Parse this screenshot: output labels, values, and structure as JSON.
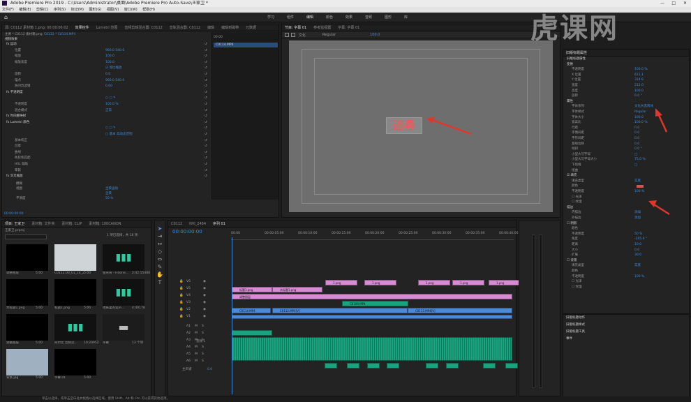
{
  "window": {
    "title": "Adobe Premiere Pro 2019 - C:\\Users\\Administrator\\桌面\\Adobe Premiere Pro Auto-Save\\王家卫 *"
  },
  "menu": [
    "文件(F)",
    "编辑(E)",
    "剪辑(C)",
    "序列(S)",
    "标记(M)",
    "图形(G)",
    "视图(V)",
    "窗口(W)",
    "帮助(H)"
  ],
  "workspaces": [
    "学习",
    "组件",
    "编辑",
    "颜色",
    "效果",
    "音频",
    "图形",
    "库"
  ],
  "watermark": "虎课网",
  "effect_controls": {
    "tabs": [
      "源: C0112 素材箱 1.png: 00:00:06:02",
      "效果控件",
      "Lumetri 范围",
      "音频剪辑混合器: C0112",
      "音轨混合器: C0112",
      "编辑",
      "编辑到磁带",
      "元数据"
    ],
    "source": "主要 * C0112 素材箱.png",
    "clip": "C0112 * C0114.MP4",
    "video_label": "视频效果",
    "timecode_start": "00:00",
    "clip_label": "C0114.MP4",
    "rows": [
      {
        "label": "fx 运动",
        "value": "",
        "h": true
      },
      {
        "label": "位置",
        "value": "960.0   540.0"
      },
      {
        "label": "缩放",
        "value": "100.0"
      },
      {
        "label": "缩放宽度",
        "value": "100.0"
      },
      {
        "label": "",
        "value": "☑ 等比缩放"
      },
      {
        "label": "旋转",
        "value": "0.0"
      },
      {
        "label": "锚点",
        "value": "960.0   540.0"
      },
      {
        "label": "防闪烁滤镜",
        "value": "0.00"
      },
      {
        "label": "fx 不透明度",
        "value": "",
        "h": true
      },
      {
        "label": "",
        "value": "○ □ ✎"
      },
      {
        "label": "不透明度",
        "value": "100.0 %"
      },
      {
        "label": "混合模式",
        "value": "正常"
      },
      {
        "label": "fx 时间重映射",
        "value": "",
        "h": true
      },
      {
        "label": "fx Lumetri 颜色",
        "value": "",
        "h": true
      },
      {
        "label": "",
        "value": "○ □ ✎"
      },
      {
        "label": "",
        "value": "□ 基本 高动态范围"
      },
      {
        "label": "基本校正",
        "value": ""
      },
      {
        "label": "创意",
        "value": ""
      },
      {
        "label": "曲线",
        "value": ""
      },
      {
        "label": "色轮和匹配",
        "value": ""
      },
      {
        "label": "HSL 辅助",
        "value": ""
      },
      {
        "label": "晕影",
        "value": ""
      },
      {
        "label": "fx 交叉缩放",
        "value": "",
        "h": true
      }
    ],
    "transition": [
      {
        "label": "模糊",
        "value": ""
      },
      {
        "label": "视图",
        "value": "全景运动"
      },
      {
        "label": "",
        "value": "全景"
      },
      {
        "label": "平滑度",
        "value": "50 %"
      }
    ],
    "timecode": "00:00:00:00"
  },
  "program": {
    "tabs": [
      "节目: 字幕 01",
      "参考监视器",
      "字幕: 字幕 01"
    ],
    "font": "文化",
    "style": "Regular",
    "size": "100.0",
    "sample_text": "追尋",
    "timecode": "00:00:00:00",
    "zoom": "适合",
    "quality": "完整",
    "duration": "00:00:40:00"
  },
  "properties": {
    "panel_title": "旧版标题属性",
    "sections": [
      {
        "label": "旧版标题属性",
        "value": "",
        "h": true
      },
      {
        "label": "变换",
        "value": "",
        "h": true
      },
      {
        "label": "不透明度",
        "value": "100.0 %"
      },
      {
        "label": "X 位置",
        "value": "611.1"
      },
      {
        "label": "Y 位置",
        "value": "314.6"
      },
      {
        "label": "宽度",
        "value": "212.0"
      },
      {
        "label": "高度",
        "value": "100.0"
      },
      {
        "label": "旋转",
        "value": "0.0 °"
      },
      {
        "label": "属性",
        "value": "",
        "h": true
      },
      {
        "label": "字体系列",
        "value": "文化长黑简体"
      },
      {
        "label": "字体样式",
        "value": "Regular"
      },
      {
        "label": "字体大小",
        "value": "100.0"
      },
      {
        "label": "宽高比",
        "value": "100.0 %"
      },
      {
        "label": "行距",
        "value": "0.0"
      },
      {
        "label": "字偶间距",
        "value": "0.0"
      },
      {
        "label": "字符间距",
        "value": "0.0"
      },
      {
        "label": "基线位移",
        "value": "0.0"
      },
      {
        "label": "倾斜",
        "value": "0.0 °"
      },
      {
        "label": "小型大写字母",
        "value": "□"
      },
      {
        "label": "小型大写字母大小",
        "value": "75.0 %"
      },
      {
        "label": "下划线",
        "value": "□"
      },
      {
        "label": "扭曲",
        "value": ""
      },
      {
        "label": "☑ 填充",
        "value": "",
        "h": true
      },
      {
        "label": "填充类型",
        "value": "实底"
      },
      {
        "label": "颜色",
        "value": ""
      },
      {
        "label": "不透明度",
        "value": "100 %"
      },
      {
        "label": "☐ 光泽",
        "value": ""
      },
      {
        "label": "☐ 纹理",
        "value": ""
      },
      {
        "label": "描边",
        "value": "",
        "h": true
      },
      {
        "label": "内描边",
        "value": "添加"
      },
      {
        "label": "外描边",
        "value": "添加"
      },
      {
        "label": "☐ 阴影",
        "value": "",
        "h": true
      },
      {
        "label": "颜色",
        "value": ""
      },
      {
        "label": "不透明度",
        "value": "50 %"
      },
      {
        "label": "角度",
        "value": "-205.0 °"
      },
      {
        "label": "距离",
        "value": "10.0"
      },
      {
        "label": "大小",
        "value": "0.0"
      },
      {
        "label": "扩展",
        "value": "30.0"
      },
      {
        "label": "☐ 背景",
        "value": "",
        "h": true
      },
      {
        "label": "填充类型",
        "value": "实底"
      },
      {
        "label": "颜色",
        "value": ""
      },
      {
        "label": "不透明度",
        "value": "100 %"
      },
      {
        "label": "☐ 光泽",
        "value": ""
      },
      {
        "label": "☐ 纹理",
        "value": ""
      }
    ],
    "footer": [
      "旧版标题动作",
      "旧版标题样式",
      "旧版标题工具",
      "事件"
    ],
    "fill_color": "#d9534a"
  },
  "project": {
    "tabs": [
      "项目: 王家卫",
      "素材箱: 文件夹",
      "素材箱: CLIP",
      "素材箱: 100CANON"
    ],
    "project_name": "王家卫.prproj",
    "count": "1 项已选择，共 16 项",
    "items": [
      {
        "name": "调整图层",
        "dur": "5:00"
      },
      {
        "name": "C0112.00_01_14_23.5...",
        "dur": "5:00"
      },
      {
        "name": "极光背 - Fidone...",
        "dur": "2:42:15488"
      },
      {
        "name": "木标题1.png",
        "dur": "5:00"
      },
      {
        "name": "标题1.png",
        "dur": "5:00"
      },
      {
        "name": "地铁里的谈声...",
        "dur": "4:40178"
      },
      {
        "name": "调整图层",
        "dur": "5:00"
      },
      {
        "name": "阿尔比 音频流...",
        "dur": "10:20952"
      },
      {
        "name": "字幕",
        "dur": "13 个项"
      },
      {
        "name": "背景.jpg",
        "dur": "5:00"
      },
      {
        "name": "字幕 01",
        "dur": "5:00"
      }
    ]
  },
  "timeline": {
    "tabs": [
      "C0112",
      "NVI_2484",
      "序列 01"
    ],
    "timecode": "00:00:00:00",
    "ruler": [
      "00:00",
      "00:00:05:00",
      "00:00:10:00",
      "00:00:15:00",
      "00:00:20:00",
      "00:00:25:00",
      "00:00:30:00",
      "00:00:35:00",
      "00:00:40:00"
    ],
    "video_tracks": [
      "V6",
      "V5",
      "V4",
      "V3",
      "V2",
      "V1"
    ],
    "audio_tracks": [
      "A1",
      "A2",
      "A3",
      "A4",
      "A5",
      "A6"
    ],
    "master": "主声道",
    "master_val": "0.0",
    "audio_label": "音频 1",
    "clips_v6": [
      "1.png",
      "1.png",
      "1.png",
      "1.png",
      "1.png"
    ],
    "clips_v5": [
      "标题1.png",
      "木标题1.png"
    ],
    "clip_v4": "调整图层",
    "clip_v3": "C0109.MP4",
    "clips_v2": [
      "C0114.MP4",
      "C0112.MP4[V]",
      "C0113.MP4[V]"
    ],
    "status": "单击以选择，或单击空白处并拖拽以选择区域，使用 Shift、Alt 和 Ctrl 可以获得其他选项。"
  }
}
